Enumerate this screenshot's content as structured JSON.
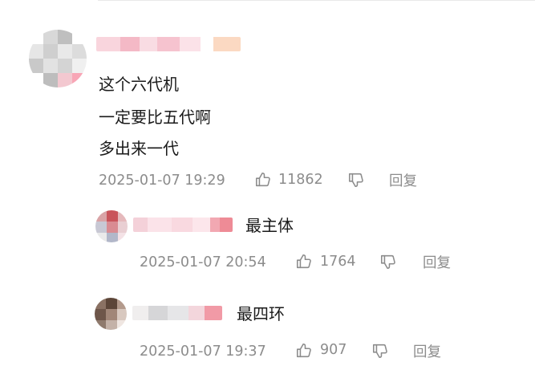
{
  "comments": [
    {
      "lines": [
        "这个六代机",
        "一定要比五代啊",
        "多出来一代"
      ],
      "timestamp": "2025-01-07 19:29",
      "likes": "11862",
      "reply_label": "回复"
    }
  ],
  "replies": [
    {
      "text": "最主体",
      "timestamp": "2025-01-07 20:54",
      "likes": "1764",
      "reply_label": "回复"
    },
    {
      "text": "最四环",
      "timestamp": "2025-01-07 19:37",
      "likes": "907",
      "reply_label": "回复"
    }
  ],
  "colors": {
    "text": "#1a1a1a",
    "meta": "#8c8c8c",
    "username_blur": "#f6c8d2"
  },
  "icons": {
    "like": "thumbs-up-icon",
    "dislike": "thumbs-down-icon"
  }
}
